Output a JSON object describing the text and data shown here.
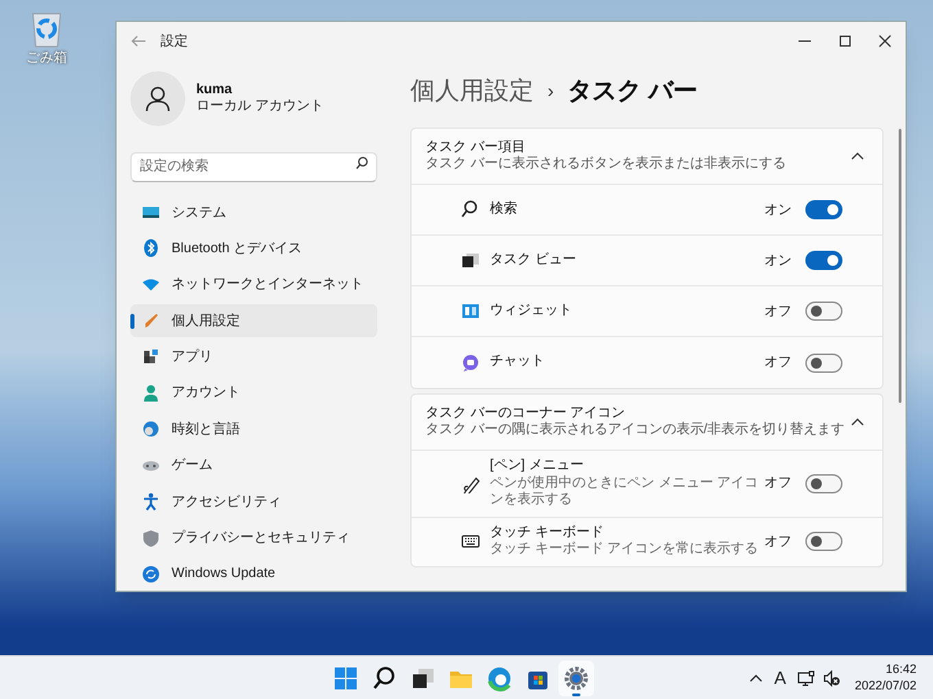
{
  "desktop_icons": [
    {
      "label": "ごみ箱"
    }
  ],
  "window": {
    "title": "設定"
  },
  "user": {
    "name": "kuma",
    "account_type": "ローカル アカウント"
  },
  "search": {
    "placeholder": "設定の検索"
  },
  "sidebar": {
    "items": [
      {
        "label": "システム",
        "selected": false
      },
      {
        "label": "Bluetooth とデバイス",
        "selected": false
      },
      {
        "label": "ネットワークとインターネット",
        "selected": false
      },
      {
        "label": "個人用設定",
        "selected": true
      },
      {
        "label": "アプリ",
        "selected": false
      },
      {
        "label": "アカウント",
        "selected": false
      },
      {
        "label": "時刻と言語",
        "selected": false
      },
      {
        "label": "ゲーム",
        "selected": false
      },
      {
        "label": "アクセシビリティ",
        "selected": false
      },
      {
        "label": "プライバシーとセキュリティ",
        "selected": false
      },
      {
        "label": "Windows Update",
        "selected": false
      }
    ]
  },
  "breadcrumb": {
    "parent": "個人用設定",
    "separator": "›",
    "current": "タスク バー"
  },
  "sections": [
    {
      "title": "タスク バー項目",
      "subtitle": "タスク バーに表示されるボタンを表示または非表示にする",
      "expanded": true,
      "items": [
        {
          "label": "検索",
          "state_text": "オン",
          "on": true
        },
        {
          "label": "タスク ビュー",
          "state_text": "オン",
          "on": true
        },
        {
          "label": "ウィジェット",
          "state_text": "オフ",
          "on": false
        },
        {
          "label": "チャット",
          "state_text": "オフ",
          "on": false
        }
      ]
    },
    {
      "title": "タスク バーのコーナー アイコン",
      "subtitle": "タスク バーの隅に表示されるアイコンの表示/非表示を切り替えます",
      "expanded": true,
      "items": [
        {
          "label": "[ペン] メニュー",
          "description": "ペンが使用中のときにペン メニュー アイコンを表示する",
          "state_text": "オフ",
          "on": false
        },
        {
          "label": "タッチ キーボード",
          "description": "タッチ キーボード アイコンを常に表示する",
          "state_text": "オフ",
          "on": false
        }
      ]
    }
  ],
  "taskbar": {
    "apps": [
      {
        "selected": false
      },
      {
        "selected": false
      },
      {
        "selected": false
      },
      {
        "selected": false
      },
      {
        "selected": false
      },
      {
        "selected": false
      },
      {
        "selected": true
      }
    ],
    "ime": "A",
    "time": "16:42",
    "date": "2022/07/02"
  }
}
